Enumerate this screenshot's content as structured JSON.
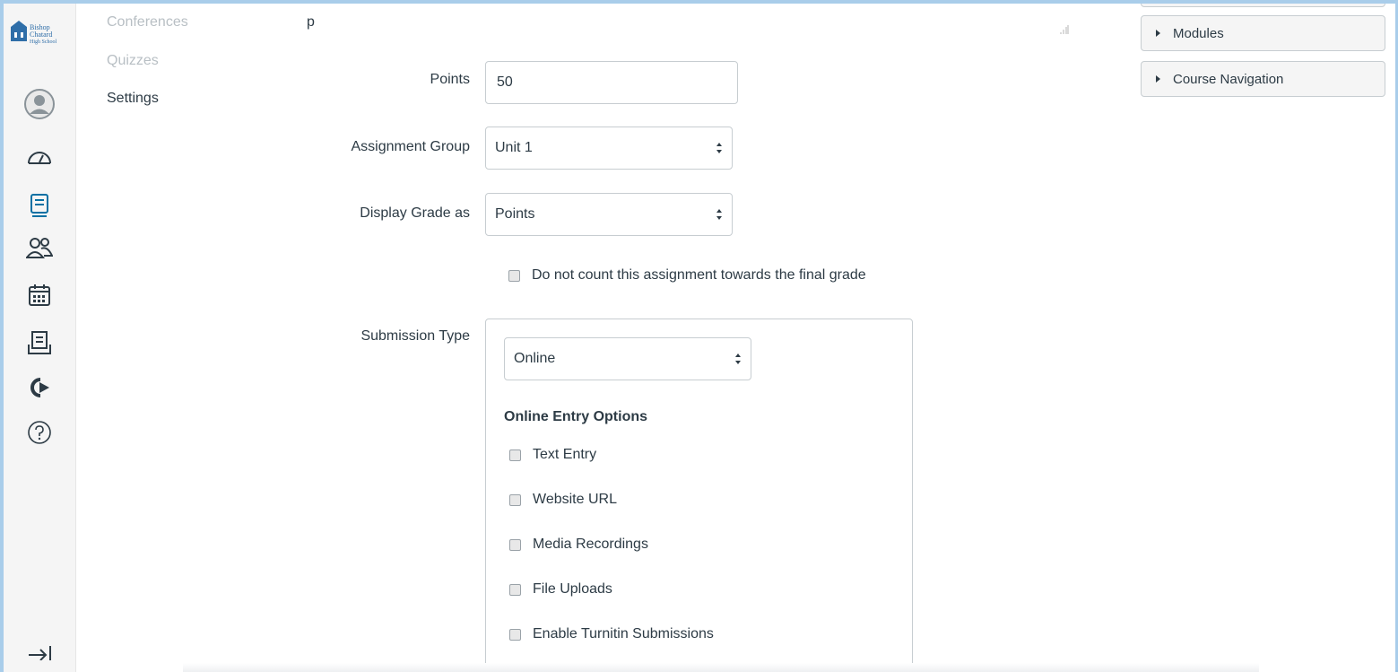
{
  "logo": {
    "line1": "Bishop",
    "line2": "Chatard",
    "line3": "High School"
  },
  "global_nav": {
    "icons": [
      "account-icon",
      "dashboard-icon",
      "courses-icon",
      "groups-icon",
      "calendar-icon",
      "inbox-icon",
      "commons-icon",
      "help-icon",
      "collapse-nav-icon"
    ]
  },
  "course_nav": {
    "items": [
      {
        "label": "Conferences",
        "state": "disabled"
      },
      {
        "label": "Quizzes",
        "state": "disabled"
      },
      {
        "label": "Settings",
        "state": "normal"
      }
    ]
  },
  "editor_tail_text": "p",
  "form": {
    "points": {
      "label": "Points",
      "value": "50"
    },
    "assignment_group": {
      "label": "Assignment Group",
      "value": "Unit 1"
    },
    "display_grade": {
      "label": "Display Grade as",
      "value": "Points"
    },
    "exclude_final": {
      "label": "Do not count this assignment towards the final grade",
      "checked": false
    },
    "submission_type": {
      "label": "Submission Type",
      "value": "Online",
      "entry_options_title": "Online Entry Options",
      "options": [
        {
          "label": "Text Entry",
          "checked": false
        },
        {
          "label": "Website URL",
          "checked": false
        },
        {
          "label": "Media Recordings",
          "checked": false
        },
        {
          "label": "File Uploads",
          "checked": false
        },
        {
          "label": "Enable Turnitin Submissions",
          "checked": false
        }
      ]
    }
  },
  "right_panel": {
    "buttons": [
      {
        "label": "Modules"
      },
      {
        "label": "Course Navigation"
      }
    ]
  },
  "colors": {
    "frame": "#a9cdea",
    "text": "#2d3b45",
    "nav_icon": "#2d3b45",
    "active_icon": "#0770a3",
    "disabled_text": "#b8bfc4",
    "border": "#c7cdd1"
  }
}
